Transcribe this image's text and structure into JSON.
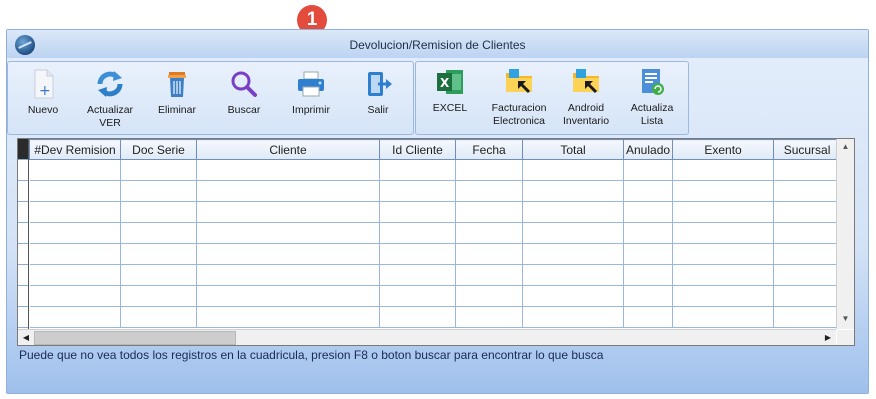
{
  "window": {
    "title": "Devolucion/Remision de Clientes"
  },
  "toolbar_main": [
    {
      "id": "nuevo",
      "label": "Nuevo",
      "icon": "new-document-icon"
    },
    {
      "id": "actualizar",
      "label": "Actualizar\nVER",
      "icon": "refresh-icon"
    },
    {
      "id": "eliminar",
      "label": "Eliminar",
      "icon": "trash-icon"
    },
    {
      "id": "buscar",
      "label": "Buscar",
      "icon": "search-icon"
    },
    {
      "id": "imprimir",
      "label": "Imprimir",
      "icon": "printer-icon"
    },
    {
      "id": "salir",
      "label": "Salir",
      "icon": "exit-icon"
    }
  ],
  "toolbar_extra": [
    {
      "id": "excel",
      "label": "EXCEL",
      "icon": "excel-icon"
    },
    {
      "id": "facturacion",
      "label": "Facturacion\nElectronica",
      "icon": "folder-arrow-icon"
    },
    {
      "id": "android",
      "label": "Android\nInventario",
      "icon": "folder-arrow-icon"
    },
    {
      "id": "actualiza",
      "label": "Actualiza\nLista",
      "icon": "list-refresh-icon"
    }
  ],
  "grid": {
    "columns": [
      "#Dev Remision",
      "Doc Serie",
      "Cliente",
      "Id Cliente",
      "Fecha",
      "Total",
      "Anulado",
      "Exento",
      "Sucursal"
    ],
    "empty_rows": 8
  },
  "hint": "Puede que no vea todos los registros en la cuadricula, presion F8 o boton buscar para encontrar lo que busca",
  "callout": {
    "number": "1"
  },
  "colors": {
    "accent": "#e34b3d",
    "window_bg": "#d3e2f6",
    "grid_line": "#9ab6d8"
  }
}
